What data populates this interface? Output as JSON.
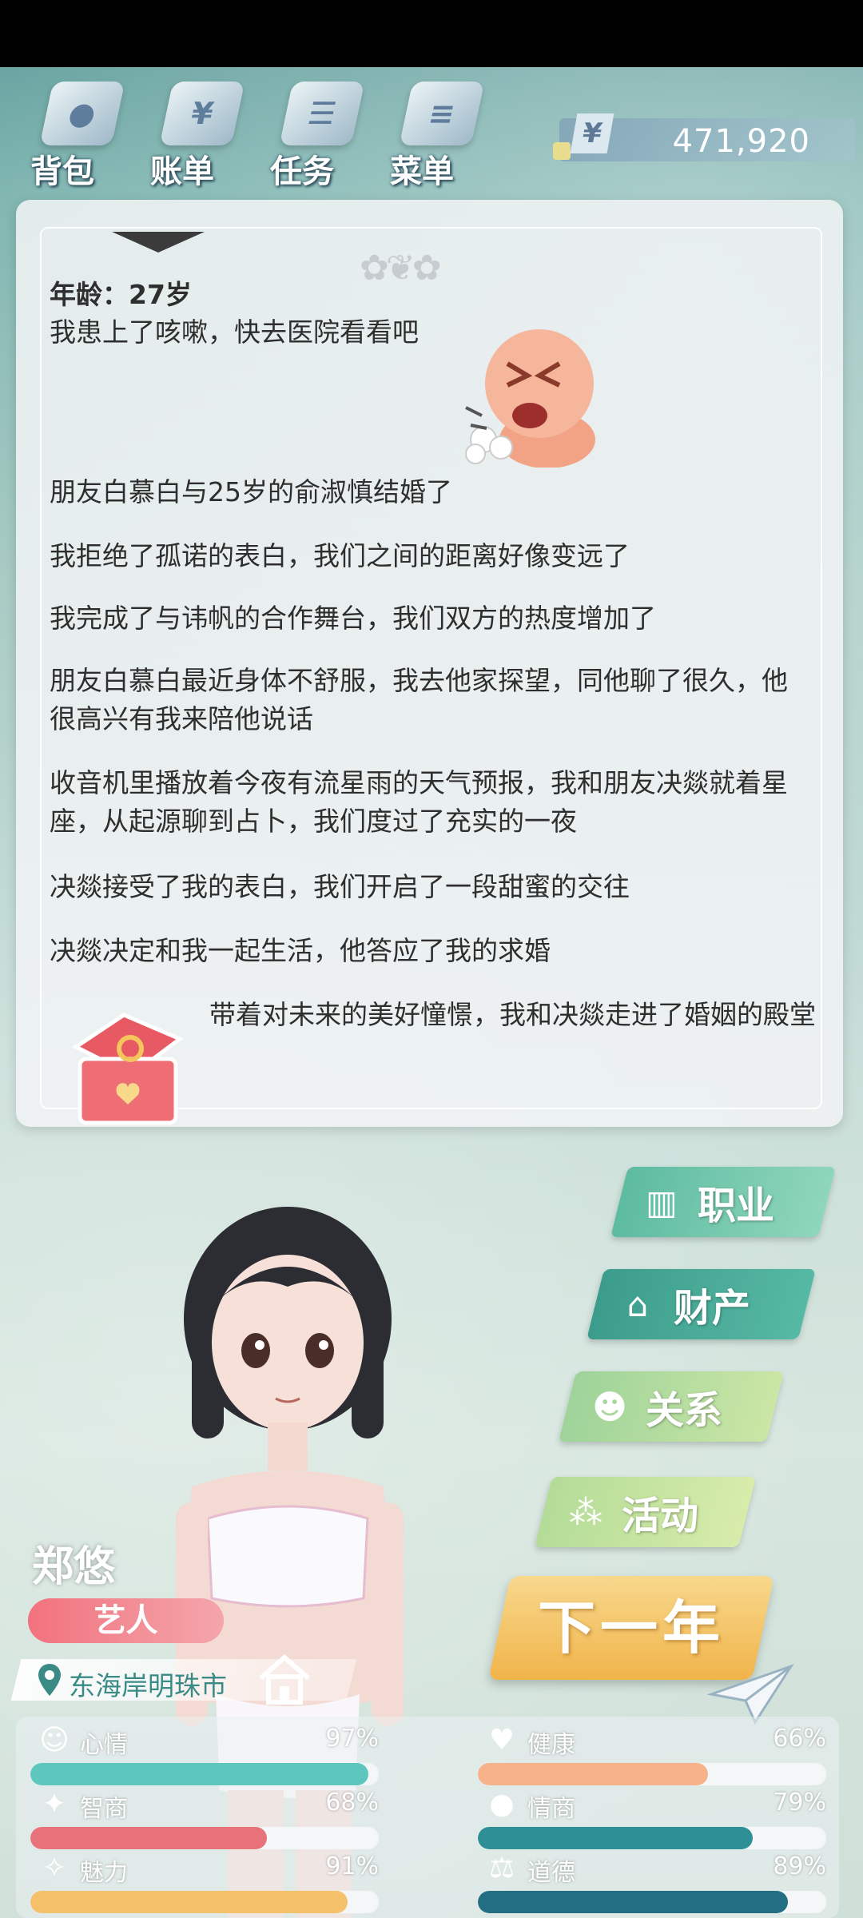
{
  "topnav": {
    "items": [
      {
        "label": "背包",
        "icon": "backpack-icon"
      },
      {
        "label": "账单",
        "icon": "bill-icon"
      },
      {
        "label": "任务",
        "icon": "task-icon"
      },
      {
        "label": "菜单",
        "icon": "menu-icon"
      }
    ],
    "money": "471,920",
    "currency_symbol": "¥"
  },
  "log": {
    "age": "年龄：27岁",
    "entries": [
      "我患上了咳嗽，快去医院看看吧",
      "朋友白慕白与25岁的俞淑慎结婚了",
      "我拒绝了孤诺的表白，我们之间的距离好像变远了",
      "我完成了与讳帆的合作舞台，我们双方的热度增加了",
      "朋友白慕白最近身体不舒服，我去他家探望，同他聊了很久，他很高兴有我来陪他说话",
      "收音机里播放着今夜有流星雨的天气预报，我和朋友决燚就着星座，从起源聊到占卜，我们度过了充实的一夜",
      "决燚接受了我的表白，我们开启了一段甜蜜的交往",
      "决燚决定和我一起生活，他答应了我的求婚",
      "带着对未来的美好憧憬，我和决燚走进了婚姻的殿堂"
    ]
  },
  "actions": {
    "career": "职业",
    "asset": "财产",
    "relation": "关系",
    "activity": "活动",
    "next_year": "下一年"
  },
  "profile": {
    "name": "郑悠",
    "job": "艺人",
    "location": "东海岸明珠市"
  },
  "stats": {
    "mood": {
      "label": "心情",
      "value": "97%",
      "fill": 0.97,
      "color": "#5ec7bd"
    },
    "iq": {
      "label": "智商",
      "value": "68%",
      "fill": 0.68,
      "color": "#e8727a"
    },
    "charm": {
      "label": "魅力",
      "value": "91%",
      "fill": 0.91,
      "color": "#f5c06a"
    },
    "health": {
      "label": "健康",
      "value": "66%",
      "fill": 0.66,
      "color": "#f6b38a"
    },
    "eq": {
      "label": "情商",
      "value": "79%",
      "fill": 0.79,
      "color": "#2f8f96"
    },
    "moral": {
      "label": "道德",
      "value": "89%",
      "fill": 0.89,
      "color": "#236e82"
    }
  }
}
